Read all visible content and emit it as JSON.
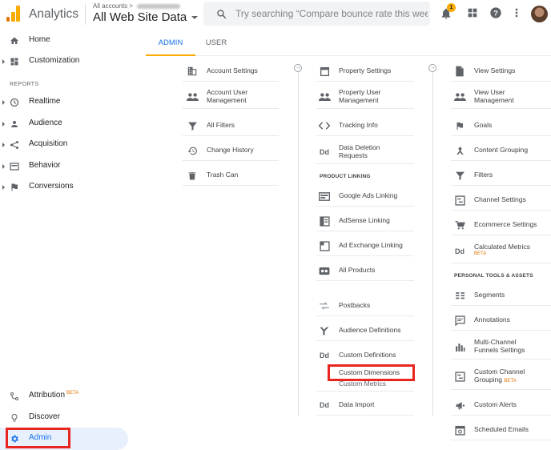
{
  "header": {
    "app_name": "Analytics",
    "breadcrumb_prefix": "All accounts",
    "breadcrumb_separator": ">",
    "property_view": "All Web Site Data",
    "search_placeholder": "Try searching “Compare bounce rate this wee...",
    "notification_count": "1",
    "accent_color": "#f9ab00"
  },
  "sidebar": {
    "home": "Home",
    "customization": "Customization",
    "reports_header": "REPORTS",
    "realtime": "Realtime",
    "audience": "Audience",
    "acquisition": "Acquisition",
    "behavior": "Behavior",
    "conversions": "Conversions",
    "attribution": "Attribution",
    "attribution_badge": "BETA",
    "discover": "Discover",
    "admin": "Admin"
  },
  "tabs": {
    "admin": "ADMIN",
    "user": "USER"
  },
  "account_col": {
    "account_settings": "Account Settings",
    "account_user_mgmt_1": "Account User",
    "account_user_mgmt_2": "Management",
    "all_filters": "All Filters",
    "change_history": "Change History",
    "trash_can": "Trash Can"
  },
  "property_col": {
    "property_settings": "Property Settings",
    "property_user_mgmt_1": "Property User",
    "property_user_mgmt_2": "Management",
    "tracking_info": "Tracking Info",
    "data_deletion_1": "Data Deletion",
    "data_deletion_2": "Requests",
    "product_linking_header": "PRODUCT LINKING",
    "google_ads_linking": "Google Ads Linking",
    "adsense_linking": "AdSense Linking",
    "ad_exchange_linking": "Ad Exchange Linking",
    "all_products": "All Products",
    "postbacks": "Postbacks",
    "audience_definitions": "Audience Definitions",
    "custom_definitions": "Custom Definitions",
    "custom_dimensions": "Custom Dimensions",
    "custom_metrics": "Custom Metrics",
    "data_import": "Data Import"
  },
  "view_col": {
    "view_settings": "View Settings",
    "view_user_mgmt_1": "View User",
    "view_user_mgmt_2": "Management",
    "goals": "Goals",
    "content_grouping": "Content Grouping",
    "filters": "Filters",
    "channel_settings": "Channel Settings",
    "ecommerce_settings": "Ecommerce Settings",
    "calculated_metrics": "Calculated Metrics",
    "calculated_metrics_badge": "BETA",
    "personal_tools_header": "PERSONAL TOOLS & ASSETS",
    "segments": "Segments",
    "annotations": "Annotations",
    "mcf_1": "Multi-Channel",
    "mcf_2": "Funnels Settings",
    "ccg_1": "Custom Channel",
    "ccg_2": "Grouping",
    "ccg_badge": "BETA",
    "custom_alerts": "Custom Alerts",
    "scheduled_emails": "Scheduled Emails"
  },
  "dd_glyph": "Dd"
}
